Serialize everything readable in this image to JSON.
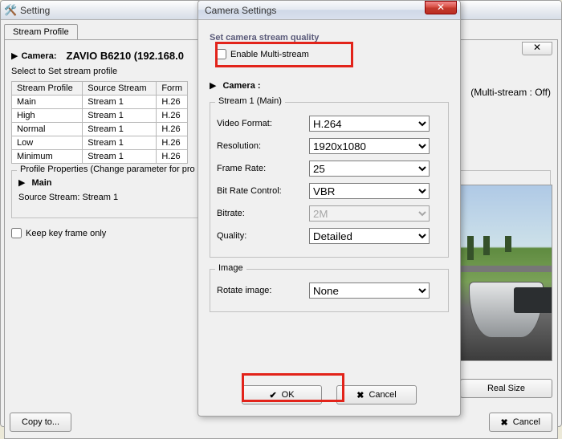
{
  "main_window": {
    "title": "Setting",
    "tab": "Stream Profile",
    "close_glyph": "✕",
    "camera_heading": "Camera:",
    "camera_name": "ZAVIO B6210 (192.168.0",
    "select_note": "Select to Set stream profile",
    "cols": {
      "c1": "Stream Profile",
      "c2": "Source Stream",
      "c3": "Form"
    },
    "rows": [
      {
        "p": "Main",
        "s": "Stream  1",
        "f": "H.26"
      },
      {
        "p": "High",
        "s": "Stream  1",
        "f": "H.26"
      },
      {
        "p": "Normal",
        "s": "Stream  1",
        "f": "H.26"
      },
      {
        "p": "Low",
        "s": "Stream  1",
        "f": "H.26"
      },
      {
        "p": "Minimum",
        "s": "Stream  1",
        "f": "H.26"
      }
    ],
    "props_legend": "Profile Properties (Change parameter for pro",
    "main_label": "Main",
    "source_stream": "Source Stream: Stream  1",
    "keep_key": "Keep key frame only",
    "copy_to": "Copy to...",
    "multi_stream_status": "(Multi-stream : Off)",
    "real_size": "Real Size",
    "cancel": "Cancel"
  },
  "dialog": {
    "title": "Camera Settings",
    "sec_quality": "Set camera stream quality",
    "enable_multi": "Enable Multi-stream",
    "camera_sec": "Camera :",
    "stream_legend": "Stream 1 (Main)",
    "labels": {
      "video_format": "Video Format:",
      "resolution": "Resolution:",
      "frame_rate": "Frame Rate:",
      "bitrate_control": "Bit Rate Control:",
      "bitrate": "Bitrate:",
      "quality": "Quality:",
      "rotate": "Rotate image:"
    },
    "values": {
      "video_format": "H.264",
      "resolution": "1920x1080",
      "frame_rate": "25",
      "bitrate_control": "VBR",
      "bitrate": "2M",
      "quality": "Detailed",
      "rotate": "None"
    },
    "image_legend": "Image",
    "ok": "OK",
    "cancel": "Cancel"
  }
}
